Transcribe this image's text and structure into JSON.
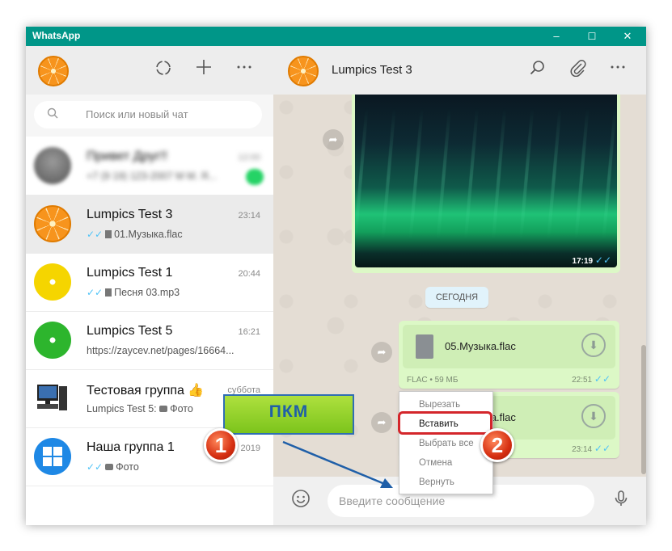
{
  "window": {
    "title": "WhatsApp",
    "minimize": "–",
    "maximize": "☐",
    "close": "✕"
  },
  "sidebar": {
    "search_placeholder": "Поиск или новый чат",
    "chats": [
      {
        "name": "Привет Друг!!",
        "time": "12:00",
        "last": "+7 (9 19) 123-2007 М М. Я..."
      },
      {
        "name": "Lumpics Test 3",
        "time": "23:14",
        "last": "01.Музыка.flac"
      },
      {
        "name": "Lumpics Test 1",
        "time": "20:44",
        "last": "Песня 03.mp3"
      },
      {
        "name": "Lumpics Test 5",
        "time": "16:21",
        "last": "https://zaycev.net/pages/16664..."
      },
      {
        "name": "Тестовая группа 👍",
        "time": "суббота",
        "last_prefix": "Lumpics Test 5:",
        "last": "Фото"
      },
      {
        "name": "Наша группа 1",
        "time": "2019",
        "last": "Фото"
      }
    ]
  },
  "main": {
    "contact_name": "Lumpics Test 3",
    "image_time": "17:19",
    "date_badge": "СЕГОДНЯ",
    "file1": {
      "name": "05.Музыка.flac",
      "meta": "FLAC • 59 МБ",
      "time": "22:51"
    },
    "file2": {
      "name": "01.Музыка.flac",
      "time": "23:14"
    },
    "composer_placeholder": "Введите сообщение"
  },
  "context_menu": {
    "items": [
      "Вырезать",
      "Вставить",
      "Выбрать все",
      "Отмена",
      "Вернуть"
    ]
  },
  "annotations": {
    "pkm_label": "ПКМ",
    "step1": "1",
    "step2": "2"
  }
}
